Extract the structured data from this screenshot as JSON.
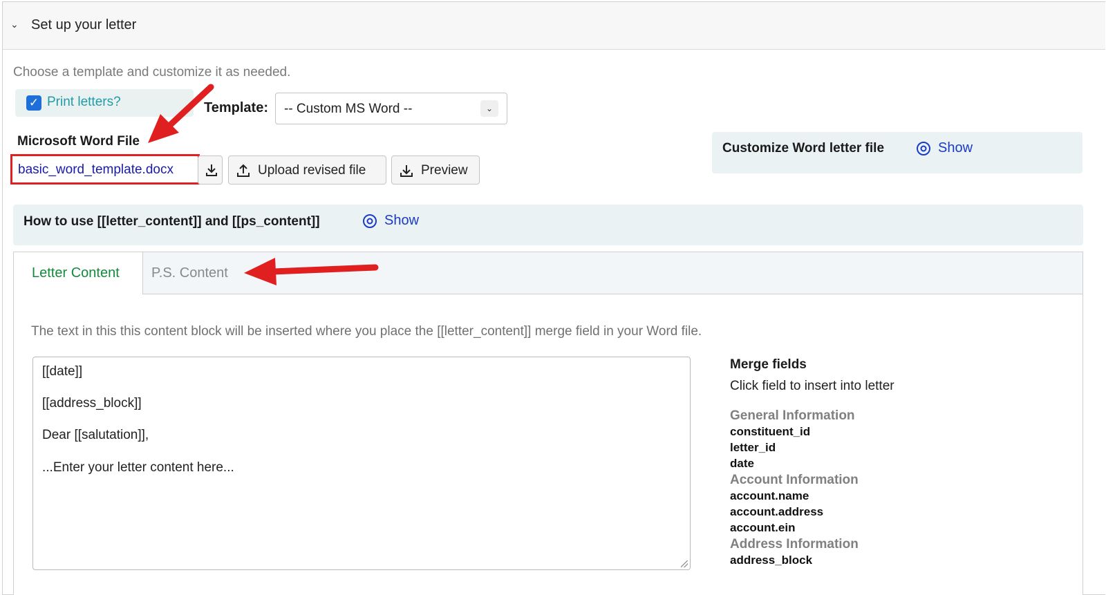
{
  "panel": {
    "title": "Set up your letter",
    "collapse_icon": "chevron-down-icon"
  },
  "intro_text": "Choose a template and customize it as needed.",
  "print_letters": {
    "label": "Print letters?",
    "checked": true
  },
  "template": {
    "label": "Template:",
    "selected": "-- Custom MS Word --"
  },
  "word_file": {
    "label": "Microsoft Word File",
    "filename": "basic_word_template.docx",
    "upload_label": "Upload revised file",
    "preview_label": "Preview"
  },
  "customize": {
    "label": "Customize Word letter file",
    "show_label": "Show"
  },
  "howto": {
    "label": "How to use [[letter_content]] and [[ps_content]]",
    "show_label": "Show"
  },
  "tabs": [
    {
      "label": "Letter Content",
      "active": true
    },
    {
      "label": "P.S. Content",
      "active": false
    }
  ],
  "content_description": "The text in this this content block will be inserted where you place the [[letter_content]] merge field in your Word file.",
  "editor_lines": [
    "[[date]]",
    "[[address_block]]",
    "Dear [[salutation]],",
    "...Enter your letter content here..."
  ],
  "merge": {
    "title": "Merge fields",
    "subtitle": "Click field to insert into letter",
    "groups": [
      {
        "name": "General Information",
        "fields": [
          "constituent_id",
          "letter_id",
          "date"
        ]
      },
      {
        "name": "Account Information",
        "fields": [
          "account.name",
          "account.address",
          "account.ein"
        ]
      },
      {
        "name": "Address Information",
        "fields": [
          "address_block"
        ]
      }
    ]
  },
  "colors": {
    "accent_teal": "#1f9ba8",
    "link_blue": "#1a3bc4",
    "active_tab_green": "#148a3c",
    "annotation_red": "#e02020"
  }
}
